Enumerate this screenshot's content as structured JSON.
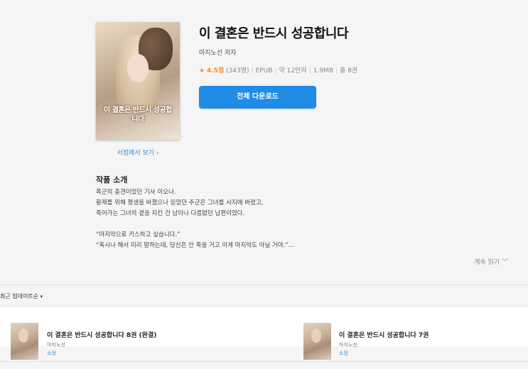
{
  "book": {
    "cover_art_text": "이 결혼은 반드시 성공합니다",
    "store_link": "서점에서 보기 ›",
    "title": "이 결혼은 반드시 성공합니다",
    "author": "마지노선 저자",
    "rating_star": "★",
    "rating_score": "4.5점",
    "rating_count": "(343명)",
    "format": "EPUB",
    "chars": "약 12만자",
    "size": "1.9MB",
    "volumes": "총 8권",
    "download_label": "전체 다운로드"
  },
  "intro": {
    "heading": "작품 소개",
    "lines": [
      "폭군의 충견이었던 기사 이오나.",
      "황제를 위해 평생을 바쳤으나 믿었던 주군은 그녀를 사지에 버렸고,",
      "죽어가는 그녀의 곁을 지킨 건 남이나 다름없던 남편이었다.",
      "“마지막으로 키스하고 싶습니다.”",
      "“혹시나 해서 미리 말하는데, 당신은 안 죽을 거고 이게 마지막도 아닐 거야.”..."
    ],
    "more": "계속 읽기 ﹀"
  },
  "sort": {
    "label": "최근 업데이트순",
    "caret": "▾"
  },
  "items": [
    {
      "title": "이 결혼은 반드시 성공합니다 8권 (완결)",
      "author": "마지노선",
      "owned": "소장"
    },
    {
      "title": "이 결혼은 반드시 성공합니다 7권",
      "author": "마지노선",
      "owned": "소장"
    }
  ],
  "colors": {
    "accent": "#1f8ce6",
    "rating": "#f6892b",
    "background": "#f5f5f5"
  },
  "icons": {
    "rating": "star-icon",
    "sort": "caret-down-icon",
    "more": "chevron-down-icon"
  }
}
